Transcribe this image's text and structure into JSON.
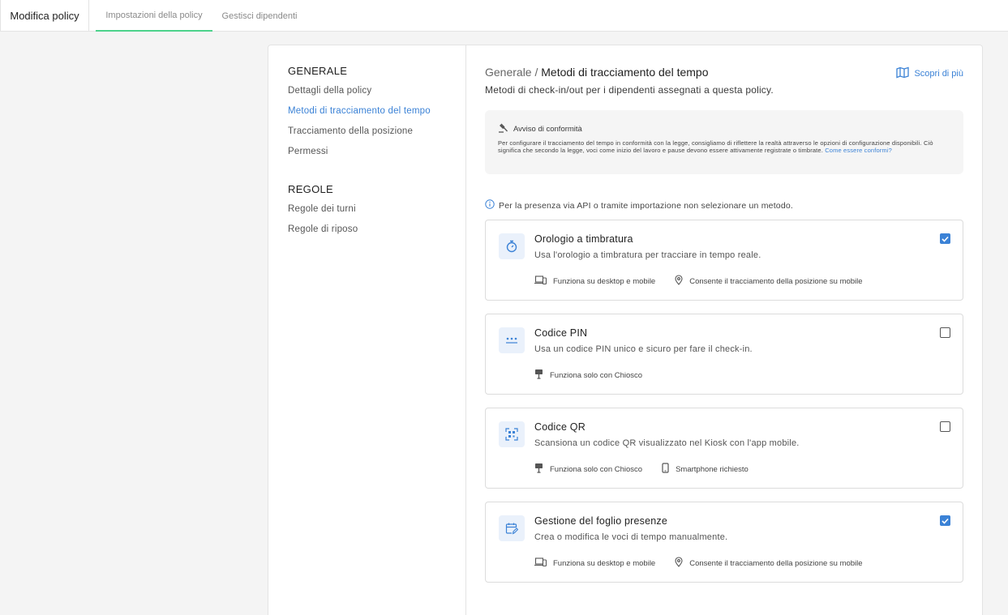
{
  "header": {
    "title": "Modifica policy",
    "tabs": [
      {
        "label": "Impostazioni della policy"
      },
      {
        "label": "Gestisci dipendenti"
      }
    ]
  },
  "sidebar": {
    "general_heading": "GENERALE",
    "general_items": [
      {
        "label": "Dettagli della policy"
      },
      {
        "label": "Metodi di tracciamento del tempo"
      },
      {
        "label": "Tracciamento della posizione"
      },
      {
        "label": "Permessi"
      }
    ],
    "rules_heading": "REGOLE",
    "rules_items": [
      {
        "label": "Regole dei turni"
      },
      {
        "label": "Regole di riposo"
      }
    ]
  },
  "main": {
    "breadcrumb_parent": "Generale",
    "breadcrumb_sep": " / ",
    "breadcrumb_current": "Metodi di tracciamento del tempo",
    "learn_more": "Scopri di più",
    "subtitle": "Metodi di check-in/out per i dipendenti assegnati a questa policy.",
    "notice": {
      "title": "Avviso di conformità",
      "body": "Per configurare il tracciamento del tempo in conformità con la legge, consigliamo di riflettere la realtà attraverso le opzioni di configurazione disponibili. Ciò significa che secondo la legge, voci come inizio del lavoro e pause devono essere attivamente registrate o timbrate.",
      "link": "Come essere conformi?"
    },
    "info_text": "Per la presenza via API o tramite importazione non selezionare un metodo.",
    "methods": [
      {
        "title": "Orologio a timbratura",
        "description": "Usa l'orologio a timbratura per tracciare in tempo reale.",
        "checked": true,
        "icon": "stopwatch-icon",
        "features": [
          {
            "icon": "laptop-phone-icon",
            "label": "Funziona su desktop e mobile"
          },
          {
            "icon": "location-pin-icon",
            "label": "Consente il tracciamento della posizione su mobile"
          }
        ]
      },
      {
        "title": "Codice PIN",
        "description": "Usa un codice PIN unico e sicuro per fare il check-in.",
        "checked": false,
        "icon": "pin-dots-icon",
        "features": [
          {
            "icon": "kiosk-icon",
            "label": "Funziona solo con Chiosco"
          }
        ]
      },
      {
        "title": "Codice QR",
        "description": "Scansiona un codice QR visualizzato nel Kiosk con l'app mobile.",
        "checked": false,
        "icon": "qr-scan-icon",
        "features": [
          {
            "icon": "kiosk-icon",
            "label": "Funziona solo con Chiosco"
          },
          {
            "icon": "smartphone-icon",
            "label": "Smartphone richiesto"
          }
        ]
      },
      {
        "title": "Gestione del foglio presenze",
        "description": "Crea o modifica le voci di tempo manualmente.",
        "checked": true,
        "icon": "calendar-edit-icon",
        "features": [
          {
            "icon": "laptop-phone-icon",
            "label": "Funziona su desktop e mobile"
          },
          {
            "icon": "location-pin-icon",
            "label": "Consente il tracciamento della posizione su mobile"
          }
        ]
      }
    ]
  },
  "colors": {
    "accent": "#3b82d6",
    "tab_underline": "#4cd28b",
    "icon_bg": "#eaf1fb"
  }
}
